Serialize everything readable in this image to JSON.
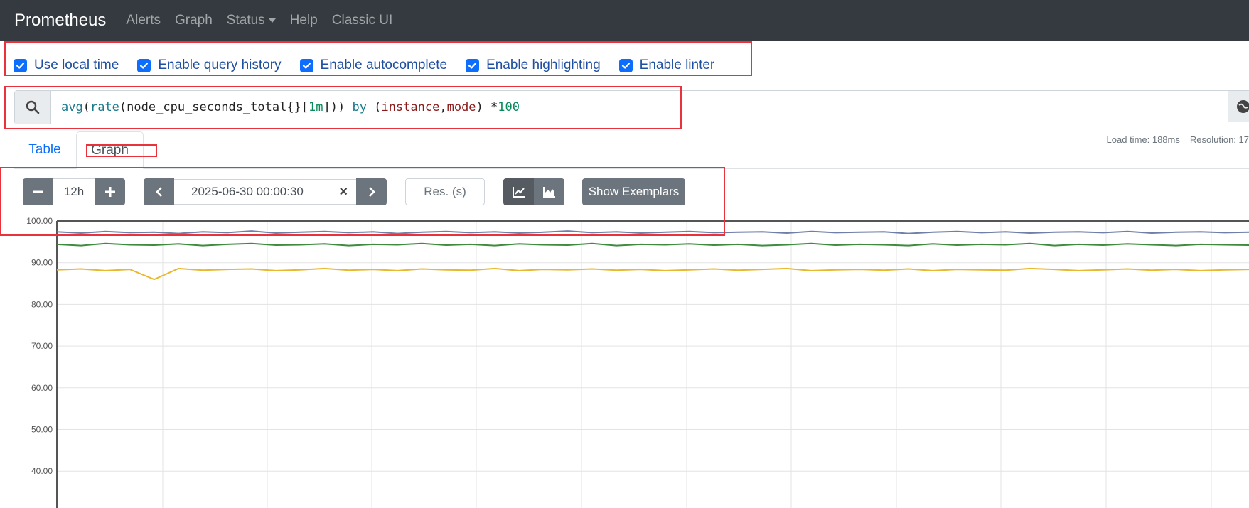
{
  "navbar": {
    "brand": "Prometheus",
    "items": [
      {
        "label": "Alerts"
      },
      {
        "label": "Graph"
      },
      {
        "label": "Status"
      },
      {
        "label": "Help"
      },
      {
        "label": "Classic UI"
      }
    ]
  },
  "options": [
    {
      "label": "Use local time",
      "checked": true
    },
    {
      "label": "Enable query history",
      "checked": true
    },
    {
      "label": "Enable autocomplete",
      "checked": true
    },
    {
      "label": "Enable highlighting",
      "checked": true
    },
    {
      "label": "Enable linter",
      "checked": true
    }
  ],
  "query": {
    "tokens": {
      "avg": "avg",
      "lp1": "(",
      "rate": "rate",
      "lp2": "(",
      "metric": "node_cpu_seconds_total{}[",
      "range": "1m",
      "rest1": "])) ",
      "by": "by",
      "lp3": " (",
      "l1": "instance",
      "comma": ",",
      "l2": "mode",
      "rest2": ") *",
      "num": "100"
    }
  },
  "tabs": {
    "table": "Table",
    "graph": "Graph"
  },
  "stats": {
    "load_time": "Load time: 188ms",
    "resolution": "Resolution: 17"
  },
  "controls": {
    "range": "12h",
    "end_time": "2025-06-30 00:00:30",
    "res_placeholder": "Res. (s)",
    "show_exemplars": "Show Exemplars"
  },
  "colors": {
    "accent": "#0d6efd",
    "annotation": "#e8333d",
    "series_blue": "#6f7fa8",
    "series_green": "#3e8b3e",
    "series_yellow": "#e8b830"
  },
  "chart_data": {
    "type": "line",
    "y_ticks": [
      "100.00",
      "90.00",
      "80.00",
      "70.00",
      "60.00",
      "50.00",
      "40.00"
    ],
    "ylim": [
      35,
      100
    ],
    "grid": true,
    "series": [
      {
        "color": "#6f7fa8",
        "values": [
          97.4,
          97.1,
          97.5,
          97.2,
          97.3,
          97.0,
          97.4,
          97.2,
          97.6,
          97.1,
          97.3,
          97.5,
          97.2,
          97.4,
          97.0,
          97.3,
          97.5,
          97.2,
          97.4,
          97.1,
          97.3,
          97.6,
          97.2,
          97.4,
          97.1,
          97.3,
          97.5,
          97.2,
          97.3,
          97.4,
          97.1,
          97.5,
          97.2,
          97.3,
          97.4,
          97.0,
          97.3,
          97.5,
          97.2,
          97.4,
          97.1,
          97.3,
          97.4,
          97.2,
          97.5,
          97.1,
          97.3,
          97.4,
          97.2,
          97.3
        ]
      },
      {
        "color": "#3e8b3e",
        "values": [
          94.4,
          94.1,
          94.6,
          94.3,
          94.2,
          94.5,
          94.1,
          94.4,
          94.6,
          94.2,
          94.3,
          94.5,
          94.1,
          94.4,
          94.3,
          94.6,
          94.2,
          94.4,
          94.1,
          94.5,
          94.3,
          94.2,
          94.6,
          94.1,
          94.4,
          94.3,
          94.5,
          94.2,
          94.4,
          94.1,
          94.3,
          94.6,
          94.2,
          94.4,
          94.3,
          94.1,
          94.5,
          94.2,
          94.4,
          94.3,
          94.6,
          94.1,
          94.4,
          94.2,
          94.5,
          94.3,
          94.1,
          94.4,
          94.3,
          94.2
        ]
      },
      {
        "color": "#e8b830",
        "values": [
          88.3,
          88.5,
          88.1,
          88.4,
          86.0,
          88.6,
          88.2,
          88.4,
          88.5,
          88.1,
          88.3,
          88.6,
          88.2,
          88.4,
          88.1,
          88.5,
          88.3,
          88.2,
          88.6,
          88.1,
          88.4,
          88.3,
          88.5,
          88.2,
          88.4,
          88.1,
          88.3,
          88.5,
          88.2,
          88.4,
          88.6,
          88.1,
          88.3,
          88.4,
          88.2,
          88.5,
          88.1,
          88.4,
          88.3,
          88.2,
          88.6,
          88.4,
          88.1,
          88.3,
          88.5,
          88.2,
          88.4,
          88.1,
          88.3,
          88.4
        ]
      }
    ]
  }
}
